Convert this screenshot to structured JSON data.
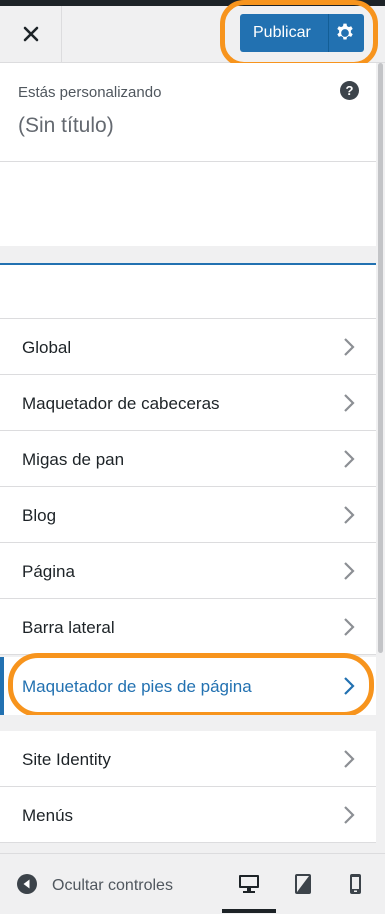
{
  "header": {
    "close_label": "×",
    "publish_label": "Publicar"
  },
  "info": {
    "label": "Estás personalizando",
    "title": "(Sin título)",
    "help_label": "?"
  },
  "menu": {
    "items": [
      {
        "label": "Global"
      },
      {
        "label": "Maquetador de cabeceras"
      },
      {
        "label": "Migas de pan"
      },
      {
        "label": "Blog"
      },
      {
        "label": "Página"
      },
      {
        "label": "Barra lateral"
      }
    ],
    "active_item": {
      "label": "Maquetador de pies de página"
    },
    "items2": [
      {
        "label": "Site Identity"
      },
      {
        "label": "Menús"
      }
    ]
  },
  "footer": {
    "collapse_label": "Ocultar controles"
  },
  "colors": {
    "accent": "#2271b1",
    "highlight": "#f7941d"
  }
}
